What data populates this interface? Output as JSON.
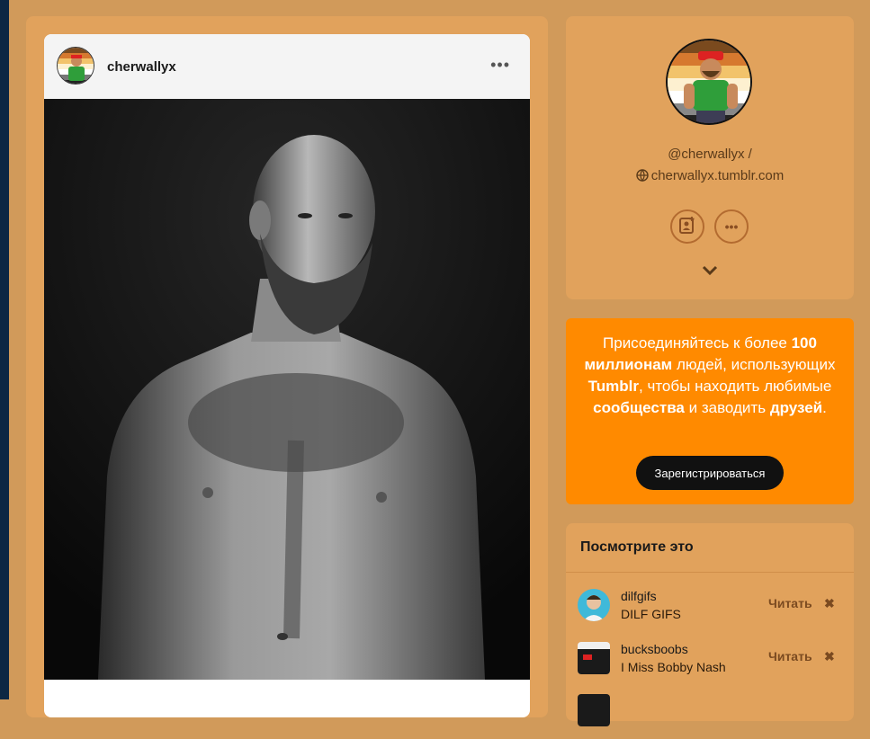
{
  "post": {
    "username": "cherwallyx",
    "menu_icon": "more-horizontal-icon"
  },
  "profile": {
    "handle": "@cherwallyx /",
    "url": "cherwallyx.tumblr.com",
    "url_icon": "globe-icon",
    "actions": [
      "follow-icon",
      "more-icon"
    ],
    "expand_icon": "chevron-down-icon"
  },
  "promo": {
    "t1": "Присоединяйтесь к более",
    "t2": "100",
    "t3": "миллионам",
    "t4": "людей,",
    "t5": "использующих",
    "t6": "Tumblr",
    "t7": ", чтобы",
    "t8": "находить любимые",
    "t9": "сообщества",
    "t10": "и",
    "t11": "заводить",
    "t12": "друзей",
    "t13": ".",
    "signup_label": "Зарегистрироваться"
  },
  "recommendations": {
    "title": "Посмотрите это",
    "follow_label": "Читать",
    "close_label": "✖",
    "items": [
      {
        "name": "dilfgifs",
        "desc": "DILF GIFS"
      },
      {
        "name": "bucksboobs",
        "desc": "I Miss Bobby Nash"
      }
    ]
  },
  "colors": {
    "accent": "#ff8a00",
    "background": "#d19a5a",
    "card": "#e1a25c"
  }
}
